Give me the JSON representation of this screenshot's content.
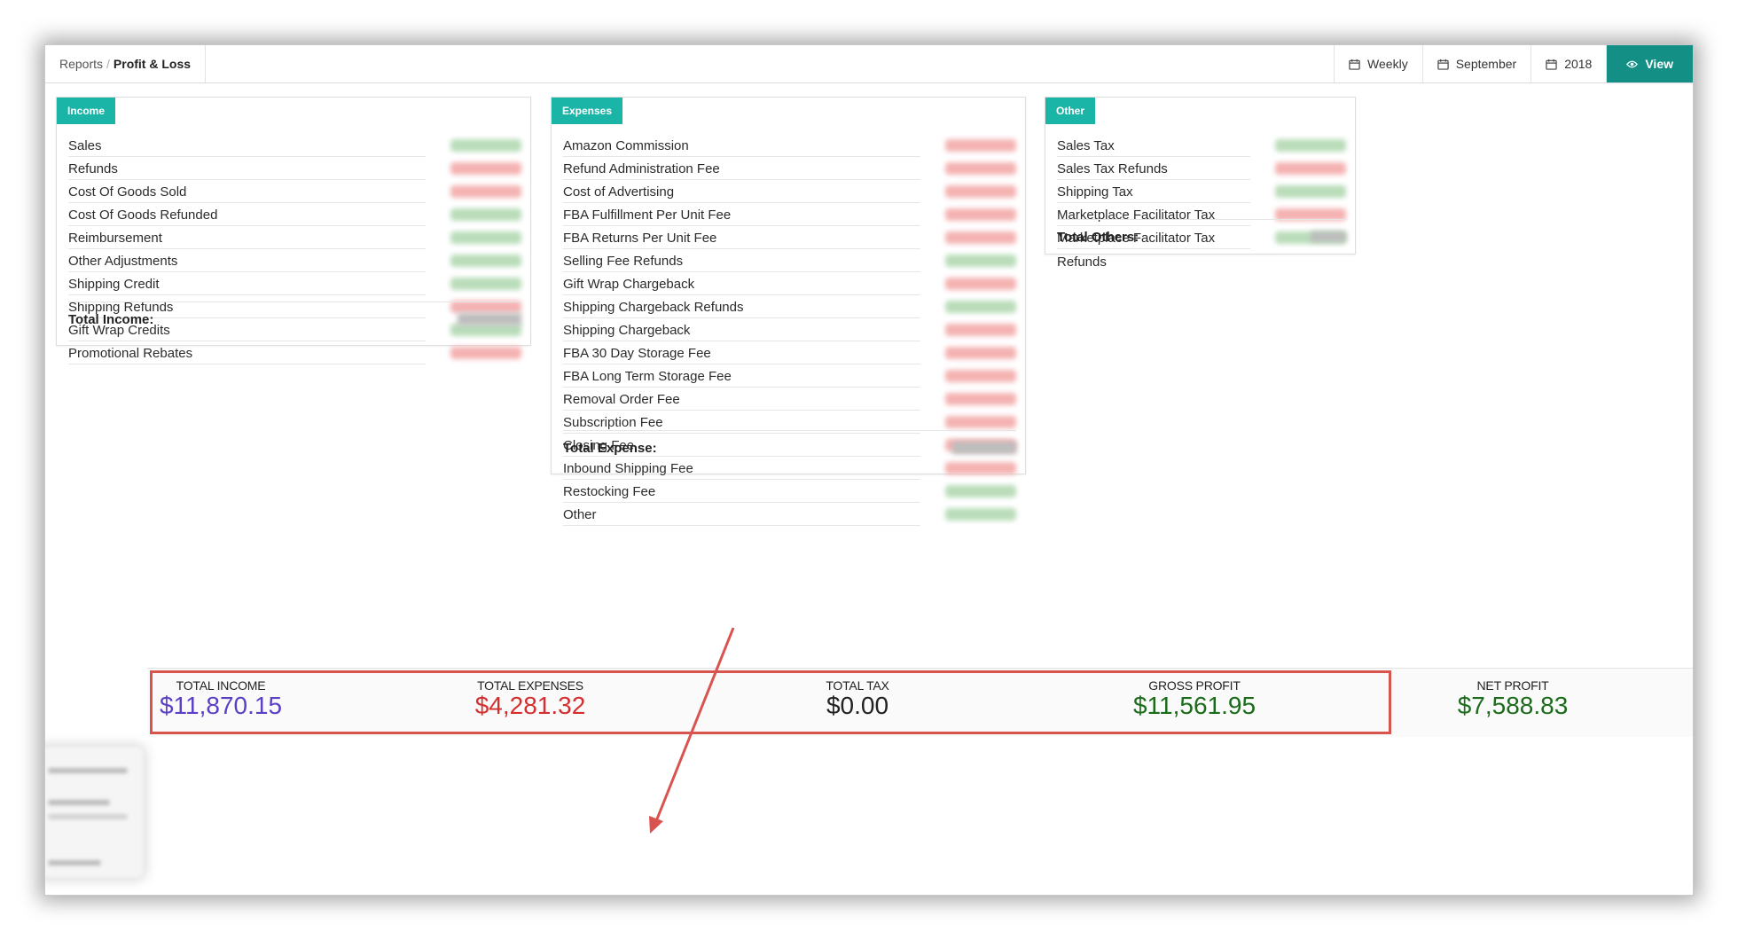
{
  "breadcrumb": {
    "root": "Reports",
    "separator": "/",
    "current": "Profit & Loss"
  },
  "toolbar": {
    "period_label": "Weekly",
    "month_label": "September",
    "year_label": "2018",
    "view_label": "View"
  },
  "income": {
    "tag": "Income",
    "items": [
      {
        "label": "Sales",
        "tone": "pos"
      },
      {
        "label": "Refunds",
        "tone": "neg"
      },
      {
        "label": "Cost Of Goods Sold",
        "tone": "neg"
      },
      {
        "label": "Cost Of Goods Refunded",
        "tone": "pos"
      },
      {
        "label": "Reimbursement",
        "tone": "pos"
      },
      {
        "label": "Other Adjustments",
        "tone": "pos"
      },
      {
        "label": "Shipping Credit",
        "tone": "pos"
      },
      {
        "label": "Shipping Refunds",
        "tone": "neg"
      },
      {
        "label": "Gift Wrap Credits",
        "tone": "pos"
      },
      {
        "label": "Promotional Rebates",
        "tone": "neg"
      }
    ],
    "total_label": "Total Income:"
  },
  "expenses": {
    "tag": "Expenses",
    "items": [
      {
        "label": "Amazon Commission",
        "tone": "neg"
      },
      {
        "label": "Refund Administration Fee",
        "tone": "neg"
      },
      {
        "label": "Cost of Advertising",
        "tone": "neg"
      },
      {
        "label": "FBA Fulfillment Per Unit Fee",
        "tone": "neg"
      },
      {
        "label": "FBA Returns Per Unit Fee",
        "tone": "neg"
      },
      {
        "label": "Selling Fee Refunds",
        "tone": "pos"
      },
      {
        "label": "Gift Wrap Chargeback",
        "tone": "neg"
      },
      {
        "label": "Shipping Chargeback Refunds",
        "tone": "pos"
      },
      {
        "label": "Shipping Chargeback",
        "tone": "neg"
      },
      {
        "label": "FBA 30 Day Storage Fee",
        "tone": "neg"
      },
      {
        "label": "FBA Long Term Storage Fee",
        "tone": "neg"
      },
      {
        "label": "Removal Order Fee",
        "tone": "neg"
      },
      {
        "label": "Subscription Fee",
        "tone": "neg"
      },
      {
        "label": "Closing Fee",
        "tone": "neg"
      },
      {
        "label": "Inbound Shipping Fee",
        "tone": "neg"
      },
      {
        "label": "Restocking Fee",
        "tone": "pos"
      },
      {
        "label": "Other",
        "tone": "pos"
      }
    ],
    "total_label": "Total Expense:"
  },
  "other": {
    "tag": "Other",
    "items": [
      {
        "label": "Sales Tax",
        "tone": "pos"
      },
      {
        "label": "Sales Tax Refunds",
        "tone": "neg"
      },
      {
        "label": "Shipping Tax",
        "tone": "pos"
      },
      {
        "label": "Marketplace Facilitator Tax",
        "tone": "neg"
      },
      {
        "label": "Marketplace Facilitator Tax Refunds",
        "tone": "pos"
      }
    ],
    "total_label": "Total Others:"
  },
  "summary": {
    "total_income": {
      "label": "TOTAL INCOME",
      "value": "$11,870.15",
      "color": "#5b3fc4"
    },
    "total_expenses": {
      "label": "TOTAL EXPENSES",
      "value": "$4,281.32",
      "color": "#d32f2f"
    },
    "total_tax": {
      "label": "TOTAL TAX",
      "value": "$0.00",
      "color": "#222222"
    },
    "gross_profit": {
      "label": "GROSS PROFIT",
      "value": "$11,561.95",
      "color": "#1b6b1b"
    },
    "net_profit": {
      "label": "NET PROFIT",
      "value": "$7,588.83",
      "color": "#1b6b1b"
    }
  },
  "colors": {
    "accent": "#1bb5a8",
    "view_button": "#138f85",
    "highlight": "#d9534f",
    "positive_blur": "#b9dcb9",
    "negative_blur": "#f4b2b2"
  },
  "icons": {
    "calendar": "calendar-icon",
    "eye": "eye-icon"
  }
}
